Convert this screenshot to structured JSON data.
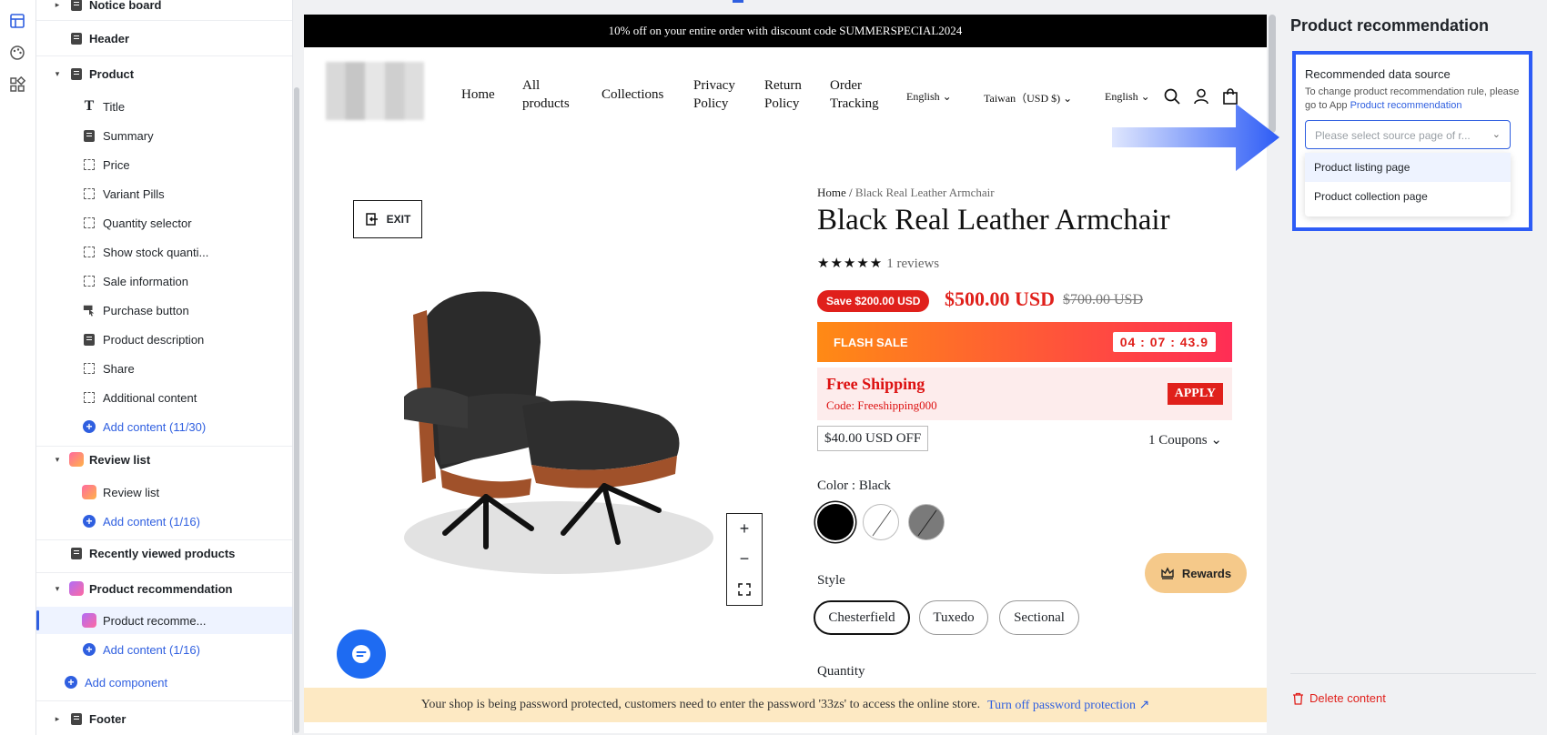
{
  "sidebar": {
    "items": [
      {
        "label": "Notice board"
      },
      {
        "label": "Header"
      },
      {
        "label": "Product"
      },
      {
        "label": "Title"
      },
      {
        "label": "Summary"
      },
      {
        "label": "Price"
      },
      {
        "label": "Variant Pills"
      },
      {
        "label": "Quantity selector"
      },
      {
        "label": "Show stock quanti..."
      },
      {
        "label": "Sale information"
      },
      {
        "label": "Purchase button"
      },
      {
        "label": "Product description"
      },
      {
        "label": "Share"
      },
      {
        "label": "Additional content"
      },
      {
        "label": "Add content (11/30)"
      },
      {
        "label": "Review list"
      },
      {
        "label": "Review list"
      },
      {
        "label": "Add content (1/16)"
      },
      {
        "label": "Recently viewed products"
      },
      {
        "label": "Product recommendation"
      },
      {
        "label": "Product recomme..."
      },
      {
        "label": "Add content (1/16)"
      },
      {
        "label": "Add component"
      },
      {
        "label": "Footer"
      }
    ]
  },
  "store": {
    "announcement": "10% off on your entire order with discount code SUMMERSPECIAL2024",
    "nav": {
      "home": "Home",
      "all_products_1": "All",
      "all_products_2": "products",
      "collections": "Collections",
      "privacy_1": "Privacy",
      "privacy_2": "Policy",
      "return_1": "Return",
      "return_2": "Policy",
      "order_1": "Order",
      "order_2": "Tracking",
      "lang1": "English",
      "region": "Taiwan（USD $)",
      "lang2": "English"
    },
    "exit_label": "EXIT",
    "breadcrumb_home": "Home",
    "breadcrumb_sep": " / ",
    "breadcrumb_current": "Black Real Leather Armchair",
    "product_title": "Black Real Leather Armchair",
    "stars": "★★★★★",
    "reviews": "1 reviews",
    "save_badge": "Save $200.00 USD",
    "price": "$500.00 USD",
    "price_old": "$700.00 USD",
    "flash_sale": "FLASH SALE",
    "timer": "04 : 07 : 43.9",
    "free_shipping": "Free Shipping",
    "shipping_code": "Code: Freeshipping000",
    "apply": "APPLY",
    "off": "$40.00 USD OFF",
    "coupons": "1 Coupons",
    "color_label": "Color : Black",
    "style_label": "Style",
    "styles": [
      "Chesterfield",
      "Tuxedo",
      "Sectional"
    ],
    "quantity_label": "Quantity",
    "rewards": "Rewards",
    "password_notice": "Your shop is being password protected, customers need to enter the password '33zs' to access the online store.",
    "password_link": "Turn off password protection"
  },
  "panel": {
    "title": "Product recommendation",
    "ds_label": "Recommended data source",
    "help_text": "To change product recommendation rule, please go to App",
    "help_link": "Product recommendation",
    "select_placeholder": "Please select source page of r...",
    "options": [
      "Product listing page",
      "Product collection page"
    ],
    "delete_label": "Delete content"
  },
  "colors": {
    "accent": "#2d5cf6",
    "sale_red": "#e0201b",
    "rewards_bg": "#f5c98a",
    "chat_blue": "#1e6bf2"
  }
}
